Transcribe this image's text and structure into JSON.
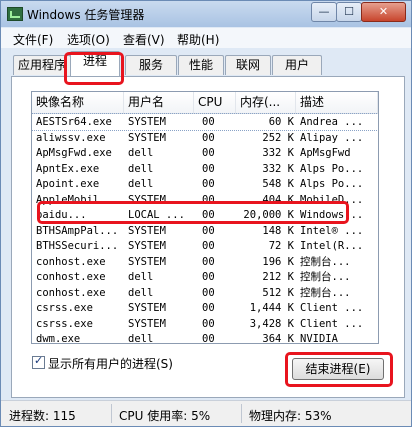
{
  "window": {
    "title": "Windows 任务管理器",
    "controls": {
      "minimize": "—",
      "maximize": "☐",
      "close": "✕"
    }
  },
  "menu": [
    "文件(F)",
    "选项(O)",
    "查看(V)",
    "帮助(H)"
  ],
  "tabs": [
    {
      "label": "应用程序"
    },
    {
      "label": "进程",
      "active": true
    },
    {
      "label": "服务"
    },
    {
      "label": "性能"
    },
    {
      "label": "联网"
    },
    {
      "label": "用户"
    }
  ],
  "columns": [
    "映像名称",
    "用户名",
    "CPU",
    "内存(...",
    "描述"
  ],
  "processes": [
    {
      "name": "AESTSr64.exe",
      "user": "SYSTEM",
      "cpu": "00",
      "mem": "60 K",
      "desc": "Andrea ..."
    },
    {
      "name": "aliwssv.exe",
      "user": "SYSTEM",
      "cpu": "00",
      "mem": "252 K",
      "desc": "Alipay ..."
    },
    {
      "name": "ApMsgFwd.exe",
      "user": "dell",
      "cpu": "00",
      "mem": "332 K",
      "desc": "ApMsgFwd"
    },
    {
      "name": "ApntEx.exe",
      "user": "dell",
      "cpu": "00",
      "mem": "332 K",
      "desc": "Alps Po..."
    },
    {
      "name": "Apoint.exe",
      "user": "dell",
      "cpu": "00",
      "mem": "548 K",
      "desc": "Alps Po..."
    },
    {
      "name": "AppleMobil...",
      "user": "SYSTEM",
      "cpu": "00",
      "mem": "404 K",
      "desc": "MobileD..."
    },
    {
      "name": "baidu...",
      "user": "LOCAL ...",
      "cpu": "00",
      "mem": "20,000 K",
      "desc": "Windows..."
    },
    {
      "name": "BTHSAmpPal...",
      "user": "SYSTEM",
      "cpu": "00",
      "mem": "148 K",
      "desc": "Intel® ..."
    },
    {
      "name": "BTHSSecuri...",
      "user": "SYSTEM",
      "cpu": "00",
      "mem": "72 K",
      "desc": "Intel(R..."
    },
    {
      "name": "conhost.exe",
      "user": "SYSTEM",
      "cpu": "00",
      "mem": "196 K",
      "desc": "控制台..."
    },
    {
      "name": "conhost.exe",
      "user": "dell",
      "cpu": "00",
      "mem": "212 K",
      "desc": "控制台..."
    },
    {
      "name": "conhost.exe",
      "user": "dell",
      "cpu": "00",
      "mem": "512 K",
      "desc": "控制台..."
    },
    {
      "name": "csrss.exe",
      "user": "SYSTEM",
      "cpu": "00",
      "mem": "1,444 K",
      "desc": "Client ..."
    },
    {
      "name": "csrss.exe",
      "user": "SYSTEM",
      "cpu": "00",
      "mem": "3,428 K",
      "desc": "Client ..."
    },
    {
      "name": "dwm.exe",
      "user": "dell",
      "cpu": "00",
      "mem": "364 K",
      "desc": "NVIDIA"
    }
  ],
  "show_all_users": {
    "label": "显示所有用户的进程(S)",
    "checked": true
  },
  "end_process_button": "结束进程(E)",
  "status": {
    "processes": "进程数: 115",
    "cpu": "CPU 使用率: 5%",
    "memory": "物理内存: 53%"
  },
  "icons": {
    "app": "task-manager-icon",
    "scroll_up": "arrow-up-icon",
    "scroll_down": "arrow-down-icon"
  },
  "colors": {
    "annotation": "#e8141e",
    "titlebar": "#b9cfea",
    "selection": "#8aa3c7"
  }
}
